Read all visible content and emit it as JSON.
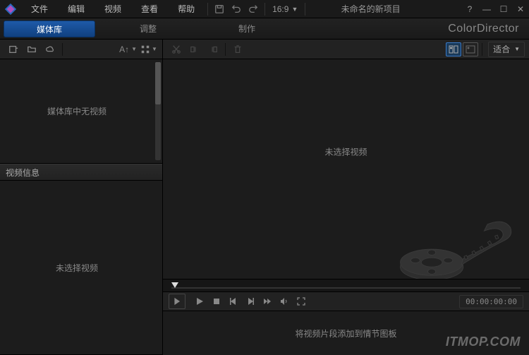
{
  "menu": {
    "file": "文件",
    "edit": "编辑",
    "video": "视频",
    "view": "查看",
    "help": "帮助"
  },
  "ratio": "16:9",
  "project_title": "未命名的新项目",
  "tabs": {
    "media": "媒体库",
    "adjust": "调整",
    "produce": "制作"
  },
  "brand": "ColorDirector",
  "sort_label": "A↑",
  "media_empty": "媒体库中无视频",
  "info_header": "视频信息",
  "info_empty": "未选择视频",
  "preview_empty": "未选择视频",
  "fit_label": "适合",
  "timecode": "00:00:00:00",
  "storyboard_hint": "将视频片段添加到情节图板",
  "watermark": "ITMOP.COM"
}
